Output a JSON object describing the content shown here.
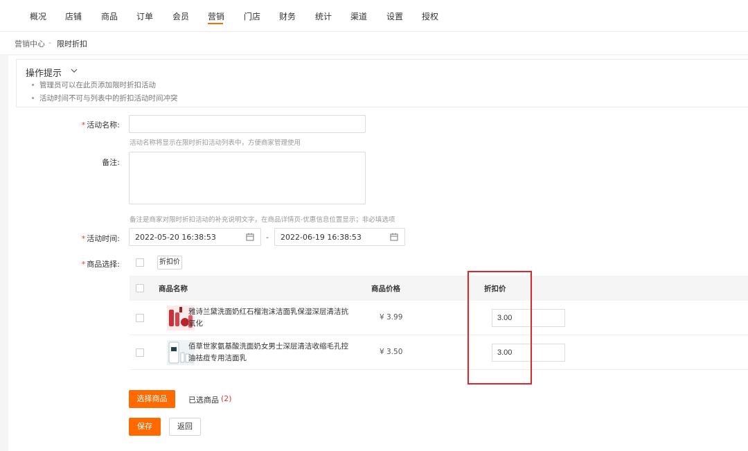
{
  "topnav": {
    "items": [
      "概况",
      "店铺",
      "商品",
      "订单",
      "会员",
      "营销",
      "门店",
      "财务",
      "统计",
      "渠道",
      "设置",
      "授权"
    ],
    "active_item": "营销",
    "accent_color": "#ff6a00"
  },
  "breadcrumb": {
    "parent": "营销中心",
    "separator": "-",
    "current": "限时折扣"
  },
  "tips": {
    "title": "操作提示",
    "lines": [
      "管理员可以在此页添加限时折扣活动",
      "活动时间不可与列表中的折扣活动时间冲突"
    ]
  },
  "form": {
    "name_label": "活动名称:",
    "name_value": "",
    "name_hint": "活动名称将显示在限时折扣活动列表中，方便商家管理使用",
    "remark_label": "备注:",
    "remark_value": "",
    "remark_hint": "备注是商家对限时折扣活动的补充说明文字，在商品详情页-优惠信息位置显示；非必填选项",
    "time_label": "活动时间:",
    "time_start": "2022-05-20 16:38:53",
    "time_separator": "-",
    "time_end": "2022-06-19 16:38:53",
    "goods_label": "商品选择:",
    "batch_discount_button": "折扣价"
  },
  "table": {
    "headers": {
      "name": "商品名称",
      "price": "商品价格",
      "discount": "折扣价"
    },
    "rows": [
      {
        "name": "雅诗兰黛洗面奶红石榴泡沫洁面乳保湿深层清洁抗氧化",
        "price": "¥ 3.99",
        "discount": "3.00"
      },
      {
        "name": "佰草世家氨基酸洗面奶女男士深层清洁收缩毛孔控油祛痘专用洁面乳",
        "price": "¥ 3.50",
        "discount": "3.00"
      }
    ]
  },
  "actions": {
    "select_goods": "选择商品",
    "selected_label": "已选商品",
    "selected_count": "(2)",
    "save": "保存",
    "back": "返回"
  },
  "colors": {
    "accent": "#ff6a00",
    "required": "#e4393c",
    "highlight_box": "#e2232a"
  }
}
